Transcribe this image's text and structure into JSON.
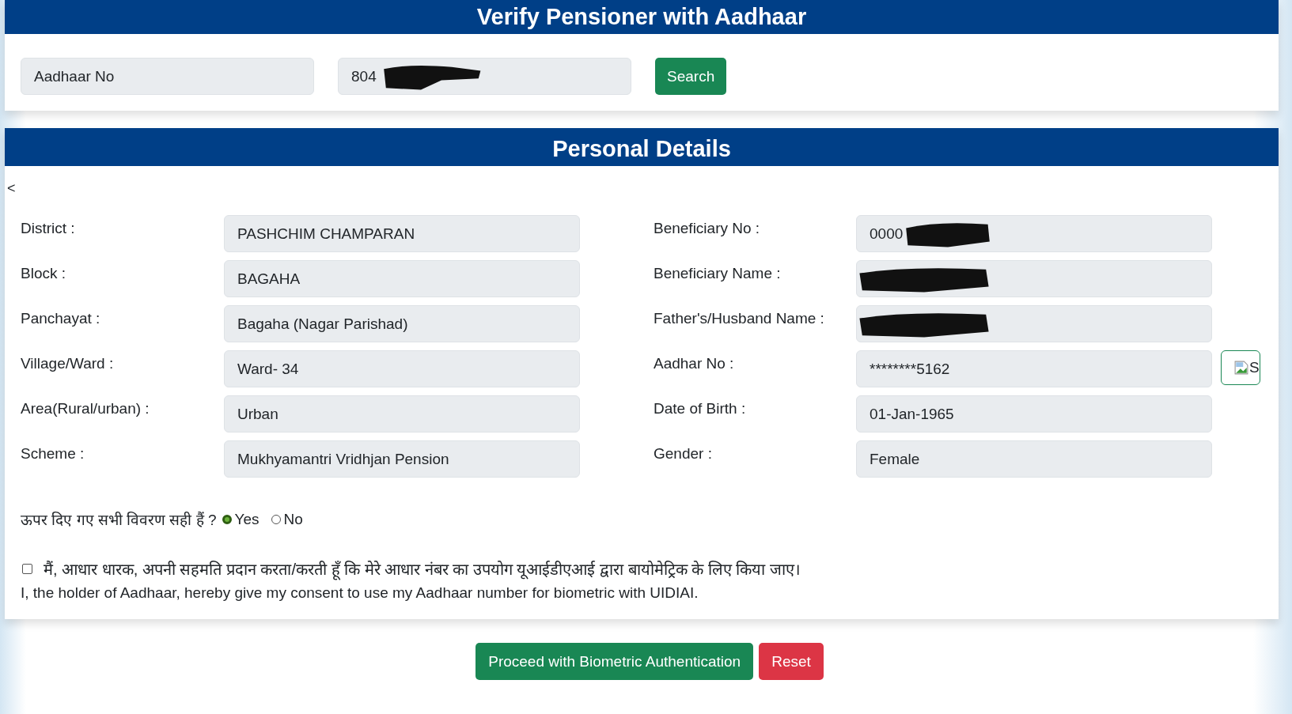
{
  "search_panel": {
    "title": "Verify Pensioner with Aadhaar",
    "field_label": {
      "value": "Aadhaar No"
    },
    "aadhaar_input": {
      "value": "804",
      "redacted": true
    },
    "button": "Search"
  },
  "personal_details": {
    "title": "Personal Details",
    "back_link": "<",
    "left_fields": [
      {
        "label": "District :",
        "value": "PASHCHIM CHAMPARAN",
        "redacted": false
      },
      {
        "label": "Block :",
        "value": "BAGAHA",
        "redacted": false
      },
      {
        "label": "Panchayat :",
        "value": "Bagaha (Nagar Parishad)",
        "redacted": false
      },
      {
        "label": "Village/Ward :",
        "value": "Ward- 34",
        "redacted": false
      },
      {
        "label": "Area(Rural/urban) :",
        "value": "Urban",
        "redacted": false
      },
      {
        "label": "Scheme :",
        "value": "Mukhyamantri Vridhjan Pension",
        "redacted": false
      }
    ],
    "right_fields": [
      {
        "label": "Beneficiary No :",
        "value": "0000",
        "redacted": true
      },
      {
        "label": "Beneficiary Name :",
        "redacted": true
      },
      {
        "label": "Father's/Husband Name :",
        "redacted": true
      },
      {
        "label": "Aadhar No :",
        "value": "********5162",
        "redacted": false,
        "photo_alt": "S"
      },
      {
        "label": "Date of Birth :",
        "value": "01-Jan-1965",
        "redacted": false
      },
      {
        "label": "Gender :",
        "value": "Female",
        "redacted": false
      }
    ],
    "confirm": {
      "question": "ऊपर दिए गए सभी विवरण सही हैं ?",
      "options": [
        {
          "label": "Yes",
          "selected": true
        },
        {
          "label": "No",
          "selected": false
        }
      ]
    },
    "consent": {
      "checked": false,
      "hindi": "मैं, आधार धारक, अपनी सहमति प्रदान करता/करती हूँ कि मेरे आधार नंबर का उपयोग यूआईडीएआई द्वारा बायोमेट्रिक के लिए किया जाए।",
      "english": "I, the holder of Aadhaar, hereby give my consent to use my Aadhaar number for biometric with UIDIAI."
    }
  },
  "actions": [
    {
      "label": "Proceed with Biometric Authentication",
      "kind": "primary"
    },
    {
      "label": "Reset",
      "kind": "danger"
    }
  ]
}
